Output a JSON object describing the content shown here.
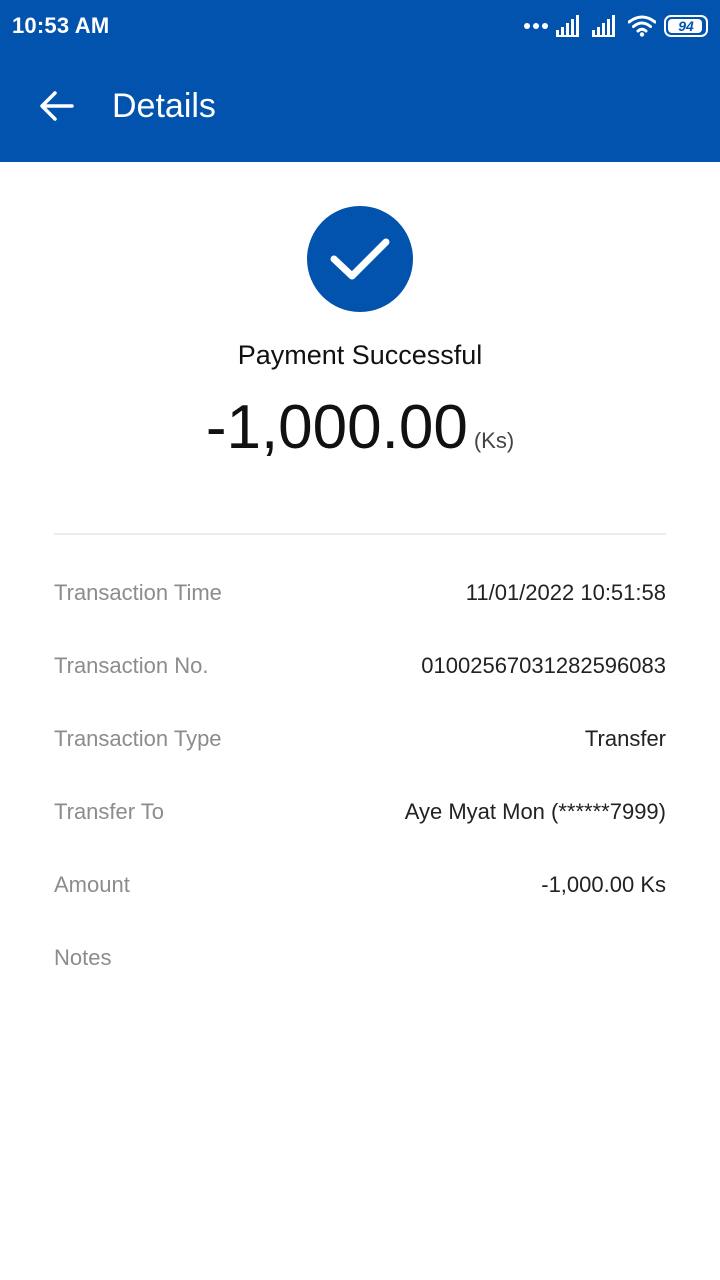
{
  "status_bar": {
    "time": "10:53 AM",
    "icons": [
      "more-dots-icon",
      "signal-icon",
      "signal-icon",
      "wifi-icon",
      "battery-icon"
    ],
    "battery_level": "94",
    "battery_fraction": 0.94
  },
  "app_bar": {
    "back_icon": "arrow-back-icon",
    "title": "Details"
  },
  "result": {
    "icon": "check-circle-icon",
    "status": "Payment Successful",
    "amount": "-1,000.00",
    "unit": "(Ks)"
  },
  "details": [
    {
      "label": "Transaction Time",
      "value": "11/01/2022 10:51:58"
    },
    {
      "label": "Transaction No.",
      "value": "01002567031282596083"
    },
    {
      "label": "Transaction Type",
      "value": "Transfer"
    },
    {
      "label": "Transfer To",
      "value": "Aye Myat Mon (******7999)"
    },
    {
      "label": "Amount",
      "value": "-1,000.00 Ks"
    },
    {
      "label": "Notes",
      "value": ""
    }
  ],
  "colors": {
    "primary": "#0253ae",
    "label_gray": "#8c8c8c",
    "text_dark": "#222222",
    "divider": "#ececec"
  }
}
